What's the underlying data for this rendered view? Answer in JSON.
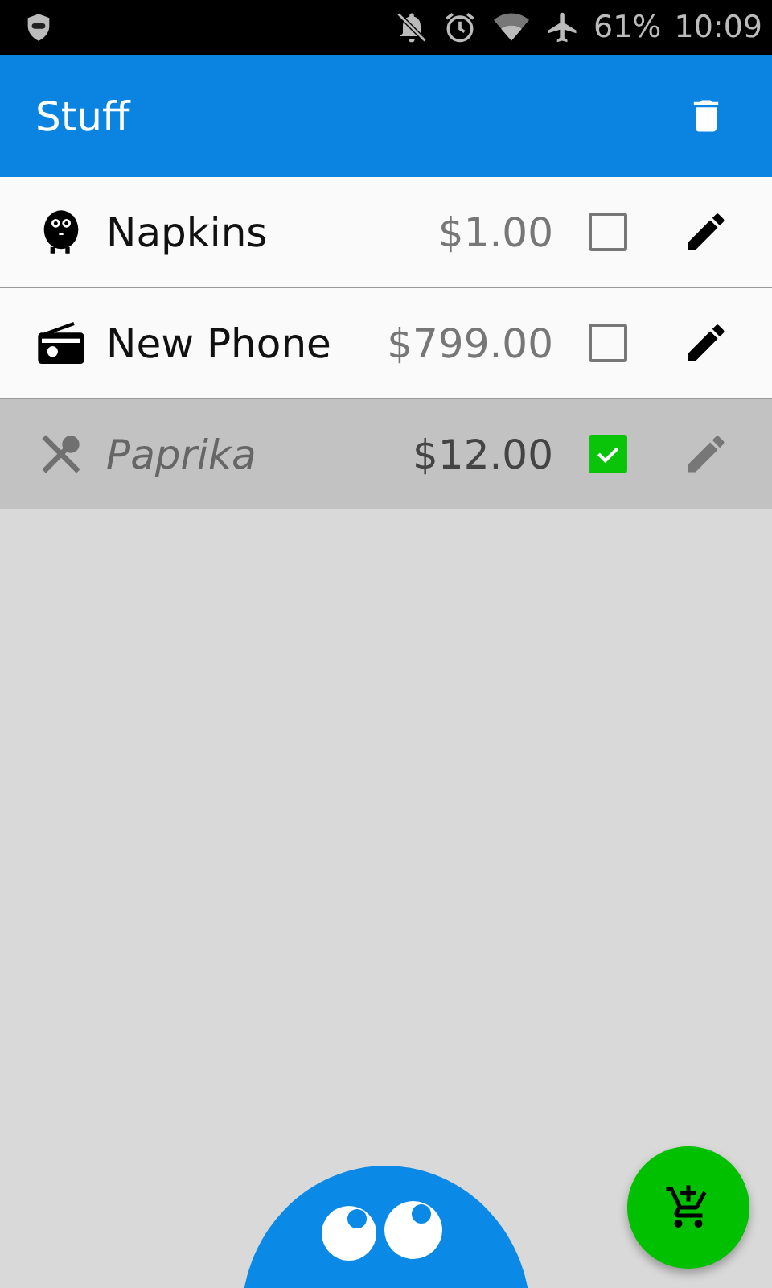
{
  "status_bar": {
    "battery": "61%",
    "time": "10:09"
  },
  "app_bar": {
    "title": "Stuff"
  },
  "items": [
    {
      "kind": "creature",
      "name": "Napkins",
      "price": "$1.00",
      "checked": false
    },
    {
      "kind": "radio",
      "name": "New Phone",
      "price": "$799.00",
      "checked": false
    },
    {
      "kind": "utensils",
      "name": "Paprika",
      "price": "$12.00",
      "checked": true
    }
  ]
}
